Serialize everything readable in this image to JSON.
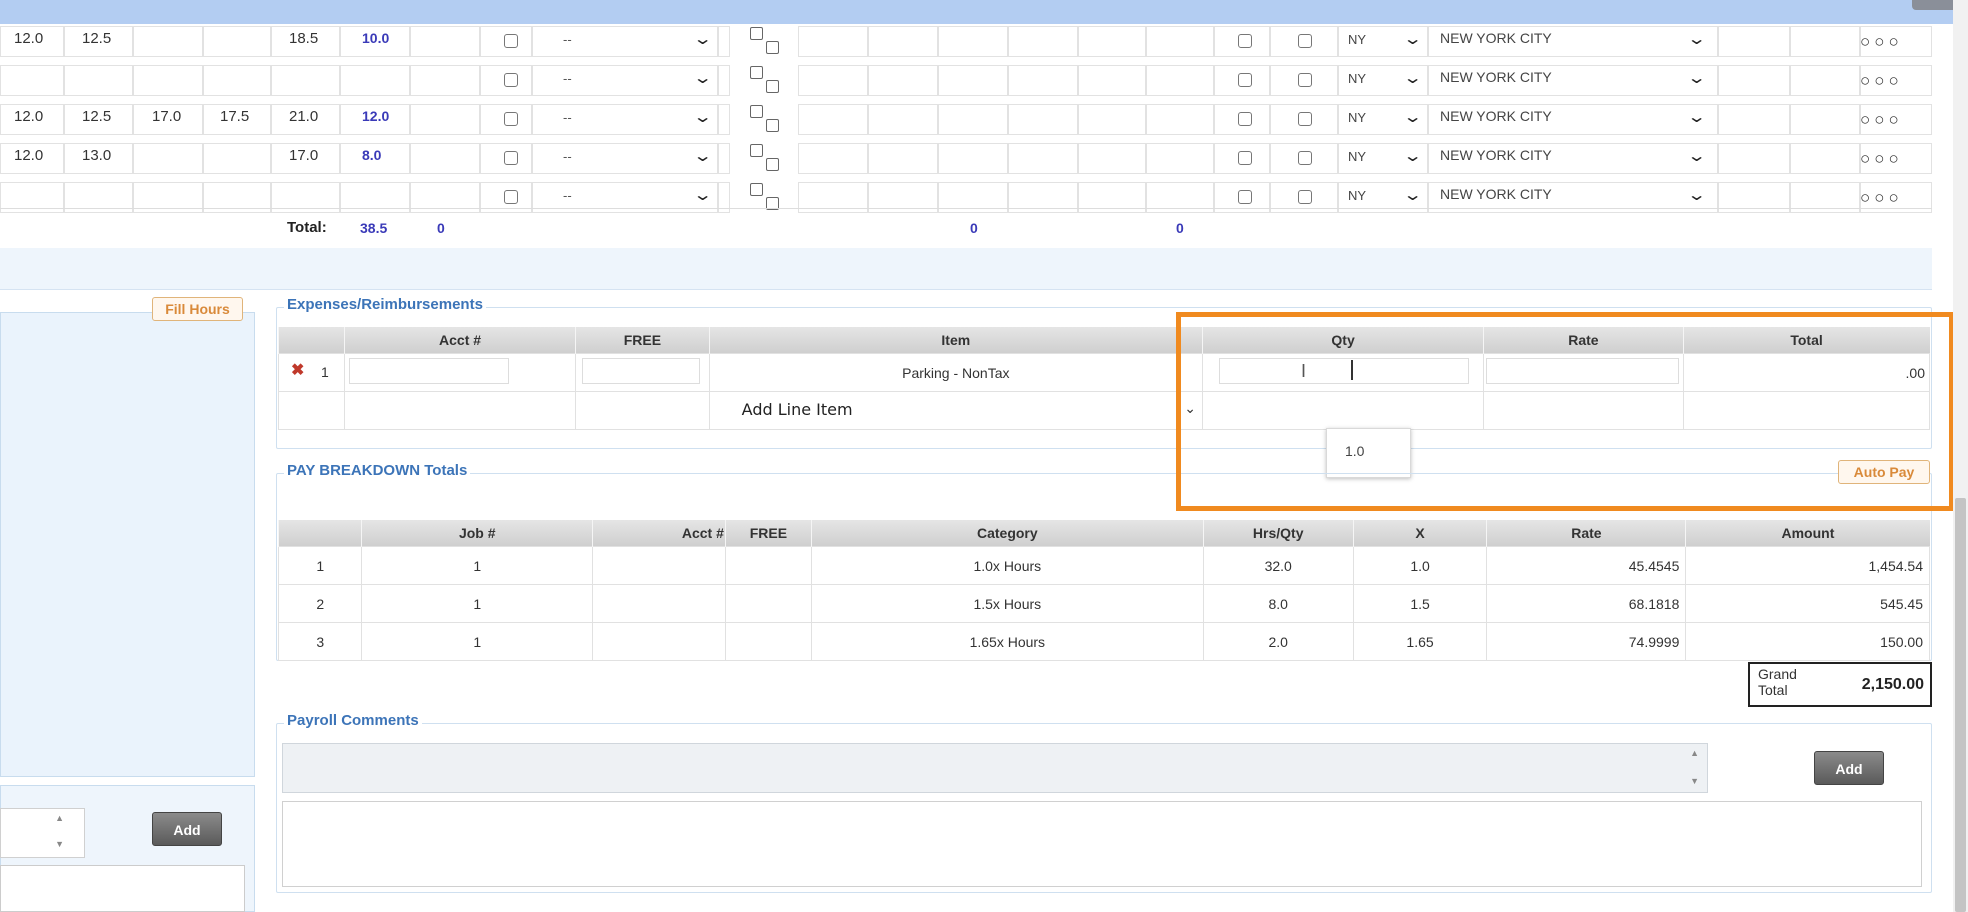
{
  "timesheet": {
    "rows": [
      {
        "c1": "12.0",
        "c2": "12.5",
        "c3": "",
        "c4": "",
        "c5": "18.5",
        "hrs": "10.0",
        "sel": "--",
        "state": "NY",
        "city": "NEW YORK CITY"
      },
      {
        "c1": "",
        "c2": "",
        "c3": "",
        "c4": "",
        "c5": "",
        "hrs": "",
        "sel": "--",
        "state": "NY",
        "city": "NEW YORK CITY"
      },
      {
        "c1": "12.0",
        "c2": "12.5",
        "c3": "17.0",
        "c4": "17.5",
        "c5": "21.0",
        "hrs": "12.0",
        "sel": "--",
        "state": "NY",
        "city": "NEW YORK CITY"
      },
      {
        "c1": "12.0",
        "c2": "13.0",
        "c3": "",
        "c4": "",
        "c5": "17.0",
        "hrs": "8.0",
        "sel": "--",
        "state": "NY",
        "city": "NEW YORK CITY"
      },
      {
        "c1": "",
        "c2": "",
        "c3": "",
        "c4": "",
        "c5": "",
        "hrs": "",
        "sel": "--",
        "state": "NY",
        "city": "NEW YORK CITY"
      }
    ],
    "totals": {
      "label": "Total:",
      "hours": "38.5",
      "a": "0",
      "b": "0",
      "c": "0"
    }
  },
  "left_panel": {
    "fill_hours": "Fill Hours",
    "add_label": "Add"
  },
  "expenses": {
    "legend": "Expenses/Reimbursements",
    "headers": [
      "",
      "Acct #",
      "FREE",
      "Item",
      "Qty",
      "Rate",
      "Total"
    ],
    "line": {
      "num": "1",
      "item": "Parking - NonTax",
      "total": ".00"
    },
    "add_line_item": "Add Line Item",
    "qty_tooltip": "1.0"
  },
  "pay_breakdown": {
    "legend": "PAY BREAKDOWN Totals",
    "auto_pay": "Auto Pay",
    "headers": [
      "",
      "Job #",
      "Acct #",
      "FREE",
      "Category",
      "Hrs/Qty",
      "X",
      "Rate",
      "Amount"
    ],
    "rows": [
      {
        "n": "1",
        "job": "1",
        "acct": "",
        "free": "",
        "category": "1.0x Hours",
        "hrs": "32.0",
        "x": "1.0",
        "rate": "45.4545",
        "amount": "1,454.54"
      },
      {
        "n": "2",
        "job": "1",
        "acct": "",
        "free": "",
        "category": "1.5x Hours",
        "hrs": "8.0",
        "x": "1.5",
        "rate": "68.1818",
        "amount": "545.45"
      },
      {
        "n": "3",
        "job": "1",
        "acct": "",
        "free": "",
        "category": "1.65x Hours",
        "hrs": "2.0",
        "x": "1.65",
        "rate": "74.9999",
        "amount": "150.00"
      }
    ],
    "grand_total_label": "Grand Total",
    "grand_total_value": "2,150.00"
  },
  "payroll_comments": {
    "legend": "Payroll Comments",
    "add_label": "Add"
  },
  "colors": {
    "accent": "#f08a1f",
    "legend": "#3c74b8",
    "hours_blue": "#3a3ab8",
    "topbar": "#b3cdf2"
  }
}
